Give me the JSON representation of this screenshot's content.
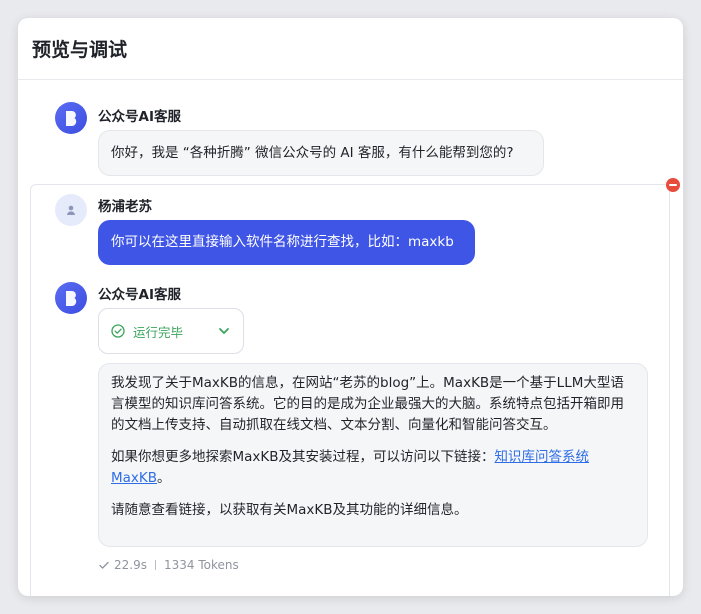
{
  "header": {
    "title": "预览与调试"
  },
  "messages": [
    {
      "sender": "公众号AI客服",
      "text": "你好，我是 “各种折腾” 微信公众号的 AI 客服，有什么能帮到您的?"
    },
    {
      "sender": "杨浦老苏",
      "text": "你可以在这里直接输入软件名称进行查找，比如：maxkb"
    },
    {
      "sender": "公众号AI客服",
      "status": "运行完毕",
      "answer": {
        "p1": "我发现了关于MaxKB的信息，在网站“老苏的blog”上。MaxKB是一个基于LLM大型语言模型的知识库问答系统。它的目的是成为企业最强大的大脑。系统特点包括开箱即用的文档上传支持、自动抓取在线文档、文本分割、向量化和智能问答交互。",
        "p2_prefix": "如果你想更多地探索MaxKB及其安装过程，可以访问以下链接：",
        "p2_link": "知识库问答系统MaxKB",
        "p2_suffix": "。",
        "p3": "请随意查看链接，以获取有关MaxKB及其功能的详细信息。"
      },
      "meta": {
        "time": "22.9s",
        "tokens": "1334 Tokens"
      }
    }
  ],
  "colors": {
    "accent": "#3f55e6",
    "success": "#3aa55c",
    "danger": "#e74c3c",
    "link": "#2f6de6"
  },
  "icons": {
    "bot_avatar": "bot-logo-icon",
    "user_avatar": "user-icon",
    "remove": "remove-circle-icon",
    "status": "check-circle-icon",
    "expand": "chevron-down-icon",
    "meta_check": "check-icon"
  }
}
